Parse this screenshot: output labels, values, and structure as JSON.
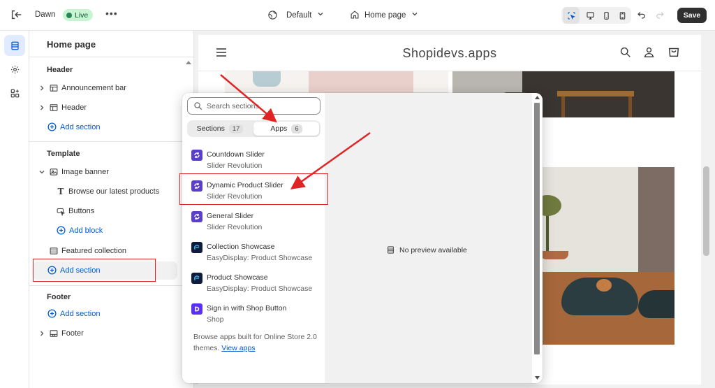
{
  "topbar": {
    "theme_name": "Dawn",
    "live_badge": "Live",
    "more_label": "•••",
    "context_label": "Default",
    "template_label": "Home page",
    "save_label": "Save",
    "accent_color": "#303030"
  },
  "sidebar": {
    "title": "Home page",
    "header_group": {
      "label": "Header",
      "items": [
        {
          "label": "Announcement bar",
          "icon": "section-icon"
        },
        {
          "label": "Header",
          "icon": "section-icon"
        }
      ],
      "add_section": "Add section"
    },
    "template_group": {
      "label": "Template",
      "image_banner": "Image banner",
      "blocks": [
        {
          "label": "Browse our latest products",
          "icon": "text-icon"
        },
        {
          "label": "Buttons",
          "icon": "button-icon"
        }
      ],
      "add_block": "Add block",
      "featured_collection": "Featured collection",
      "add_section": "Add section"
    },
    "footer_group": {
      "label": "Footer",
      "add_section": "Add section",
      "footer_item": "Footer"
    }
  },
  "store": {
    "name": "Shopidevs.apps"
  },
  "popover": {
    "search_placeholder": "Search sections",
    "tabs": [
      {
        "label": "Sections",
        "count": "17"
      },
      {
        "label": "Apps",
        "count": "6"
      }
    ],
    "active_tab": "Apps",
    "apps": [
      {
        "name": "Countdown Slider",
        "vendor": "Slider Revolution",
        "icon_color": "#5b3fc7"
      },
      {
        "name": "Dynamic Product Slider",
        "vendor": "Slider Revolution",
        "icon_color": "#5b3fc7"
      },
      {
        "name": "General Slider",
        "vendor": "Slider Revolution",
        "icon_color": "#5b3fc7"
      },
      {
        "name": "Collection Showcase",
        "vendor": "EasyDisplay: Product Showcase",
        "icon_color": "#0e1b3d"
      },
      {
        "name": "Product Showcase",
        "vendor": "EasyDisplay: Product Showcase",
        "icon_color": "#0e1b3d"
      },
      {
        "name": "Sign in with Shop Button",
        "vendor": "Shop",
        "icon_color": "#5a31f4"
      }
    ],
    "browse_text": "Browse apps built for Online Store 2.0 themes.",
    "view_apps_link": "View apps",
    "no_preview": "No preview available"
  },
  "annotations": {
    "highlight_color": "#e02424"
  }
}
